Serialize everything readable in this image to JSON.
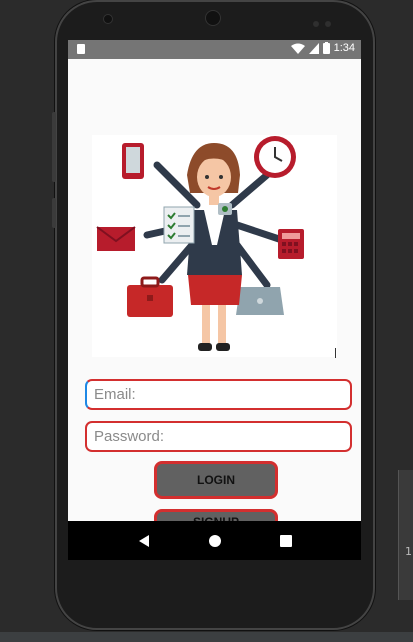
{
  "status_bar": {
    "time": "1:34",
    "icons": [
      "sim-icon",
      "wifi-icon",
      "signal-icon",
      "battery-icon"
    ]
  },
  "login_form": {
    "email_placeholder": "Email:",
    "password_placeholder": "Password:",
    "login_label": "LOGIN",
    "signup_label": "SIGNUP"
  },
  "colors": {
    "accent_border": "#d32f2f",
    "button_fill": "#616161",
    "status_bar": "#757575",
    "nav_bar": "#000000"
  },
  "navigation": {
    "buttons": [
      "back-icon",
      "home-icon",
      "recents-icon"
    ]
  },
  "ide": {
    "side_char": "1"
  }
}
